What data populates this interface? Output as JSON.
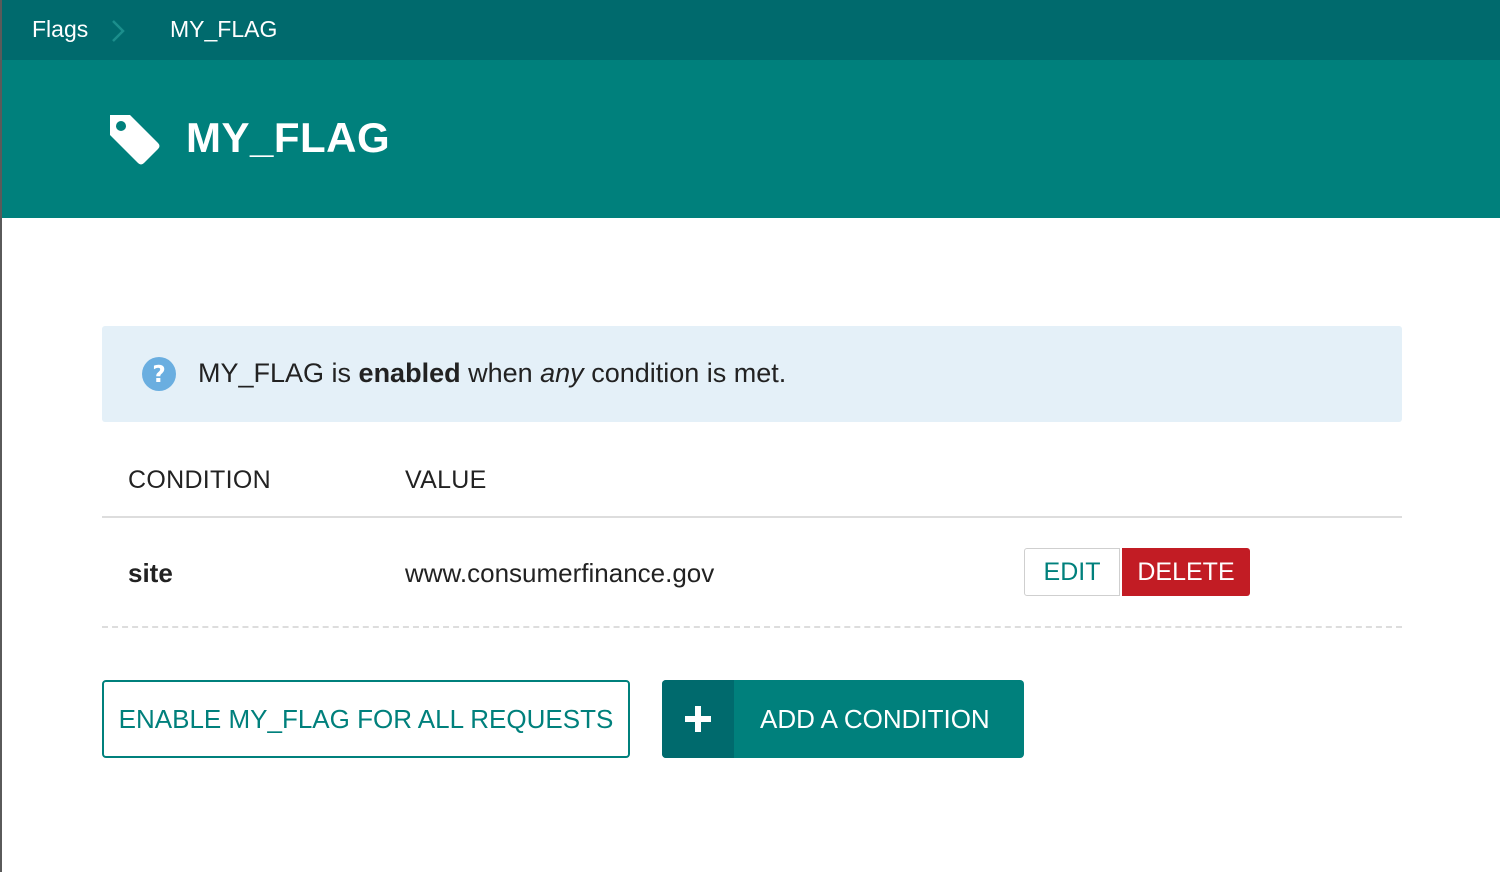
{
  "breadcrumb": {
    "root_label": "Flags",
    "separator_icon": "chevron-right-icon",
    "current_label": "MY_FLAG"
  },
  "header": {
    "icon": "tag-icon",
    "title": "MY_FLAG"
  },
  "info": {
    "icon": "question-circle-icon",
    "text_prefix": "MY_FLAG is ",
    "text_bold": "enabled",
    "text_middle": " when ",
    "text_italic": "any",
    "text_suffix": " condition is met."
  },
  "table": {
    "headers": [
      "CONDITION",
      "VALUE"
    ],
    "rows": [
      {
        "condition": "site",
        "value": "www.consumerfinance.gov",
        "edit_label": "EDIT",
        "delete_label": "DELETE"
      }
    ]
  },
  "actions": {
    "enable_label": "ENABLE MY_FLAG FOR ALL REQUESTS",
    "add_icon": "plus-icon",
    "add_label": "ADD A CONDITION"
  },
  "colors": {
    "breadcrumb_bg": "#006a6d",
    "header_bg": "#00807c",
    "info_bg": "#e4f0f8",
    "help_icon": "#6aaee0",
    "delete_bg": "#c21c24"
  }
}
